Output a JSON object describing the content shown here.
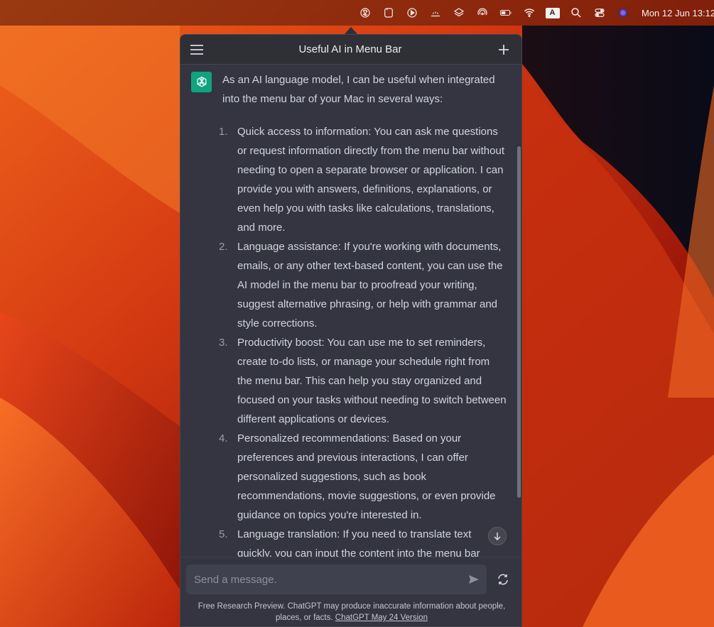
{
  "menubar": {
    "icons": [
      "chatgpt-icon",
      "tablet-icon",
      "play-icon",
      "weather-icon",
      "layers-icon",
      "airdrop-icon",
      "battery-icon",
      "wifi-icon",
      "input-source-icon",
      "search-icon",
      "control-center-icon",
      "siri-icon"
    ],
    "input_source_label": "A",
    "clock": "Mon 12 Jun  13:12"
  },
  "popover": {
    "title": "Useful AI in Menu Bar",
    "menu_icon": "hamburger-icon",
    "new_chat_icon": "plus-icon"
  },
  "message": {
    "intro": "As an AI language model, I can be useful when integrated into the menu bar of your Mac in several ways:",
    "items": [
      {
        "num": "1.",
        "text": "Quick access to information: You can ask me questions or request information directly from the menu bar without needing to open a separate browser or application. I can provide you with answers, definitions, explanations, or even help you with tasks like calculations, translations, and more."
      },
      {
        "num": "2.",
        "text": "Language assistance: If you're working with documents, emails, or any other text-based content, you can use the AI model in the menu bar to proofread your writing, suggest alternative phrasing, or help with grammar and style corrections."
      },
      {
        "num": "3.",
        "text": "Productivity boost: You can use me to set reminders, create to-do lists, or manage your schedule right from the menu bar. This can help you stay organized and focused on your tasks without needing to switch between different applications or devices."
      },
      {
        "num": "4.",
        "text": "Personalized recommendations: Based on your preferences and previous interactions, I can offer personalized suggestions, such as book recommendations, movie suggestions, or even provide guidance on topics you're interested in."
      },
      {
        "num": "5.",
        "text": "Language translation: If you need to translate text quickly, you can input the content into the menu bar"
      }
    ]
  },
  "composer": {
    "placeholder": "Send a message.",
    "value": ""
  },
  "footer": {
    "disclaimer": "Free Research Preview. ChatGPT may produce inaccurate information about people, places, or facts.",
    "version_link": "ChatGPT May 24 Version"
  },
  "colors": {
    "accent": "#10a37f",
    "panel": "#343541",
    "header": "#2f3036",
    "input": "#40414f"
  }
}
